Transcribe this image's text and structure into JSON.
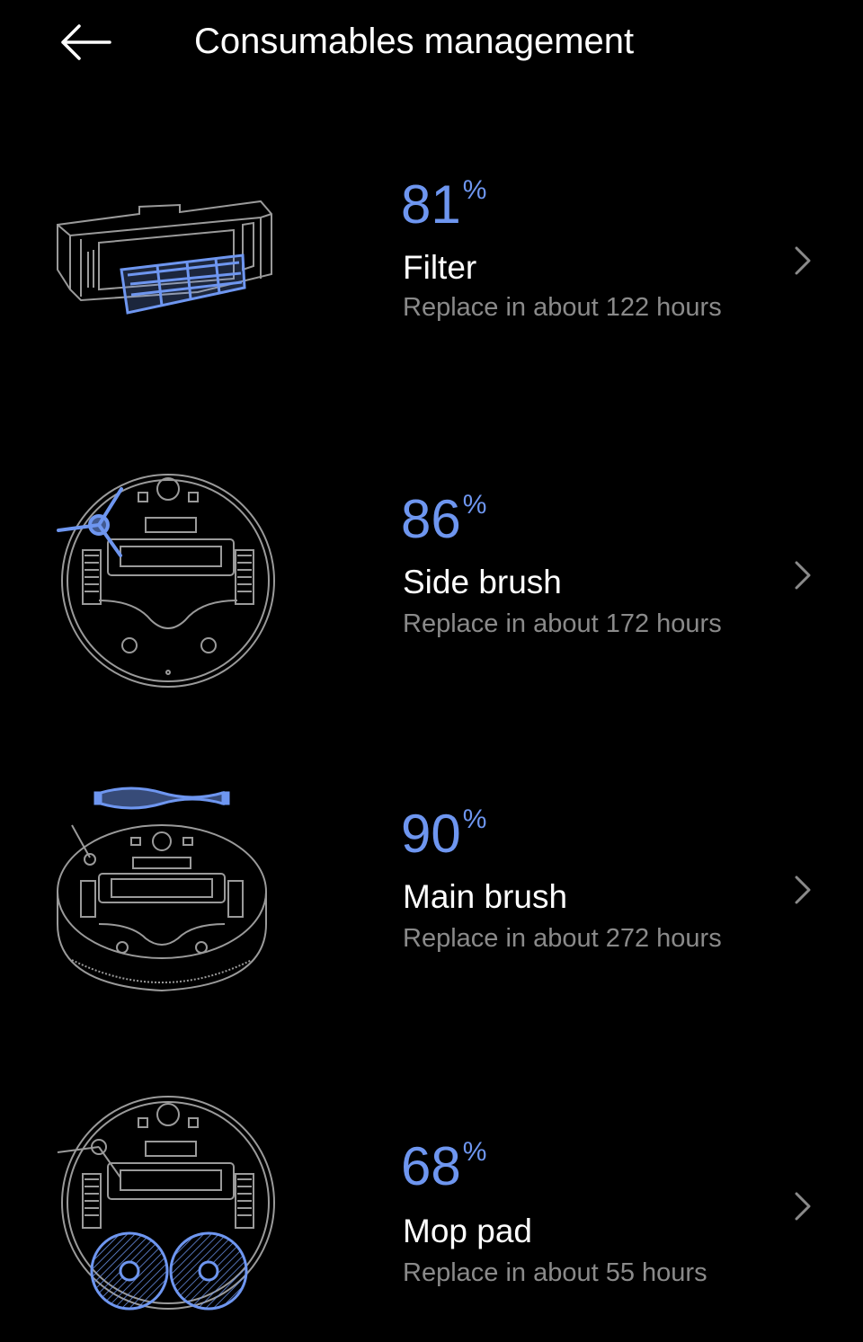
{
  "header": {
    "title": "Consumables management"
  },
  "items": [
    {
      "name": "Filter",
      "percent": "81",
      "percent_symbol": "%",
      "subtitle": "Replace in about 122 hours"
    },
    {
      "name": "Side brush",
      "percent": "86",
      "percent_symbol": "%",
      "subtitle": "Replace in about 172 hours"
    },
    {
      "name": "Main brush",
      "percent": "90",
      "percent_symbol": "%",
      "subtitle": "Replace in about 272 hours"
    },
    {
      "name": "Mop pad",
      "percent": "68",
      "percent_symbol": "%",
      "subtitle": "Replace in about 55 hours"
    }
  ],
  "colors": {
    "background": "#000000",
    "accent": "#6e96f0",
    "secondary_text": "#8a8a8a",
    "line_art": "#9a9a9a"
  },
  "icons": [
    "back-arrow-icon",
    "chevron-right-icon",
    "filter-illustration",
    "side-brush-illustration",
    "main-brush-illustration",
    "mop-pad-illustration"
  ]
}
